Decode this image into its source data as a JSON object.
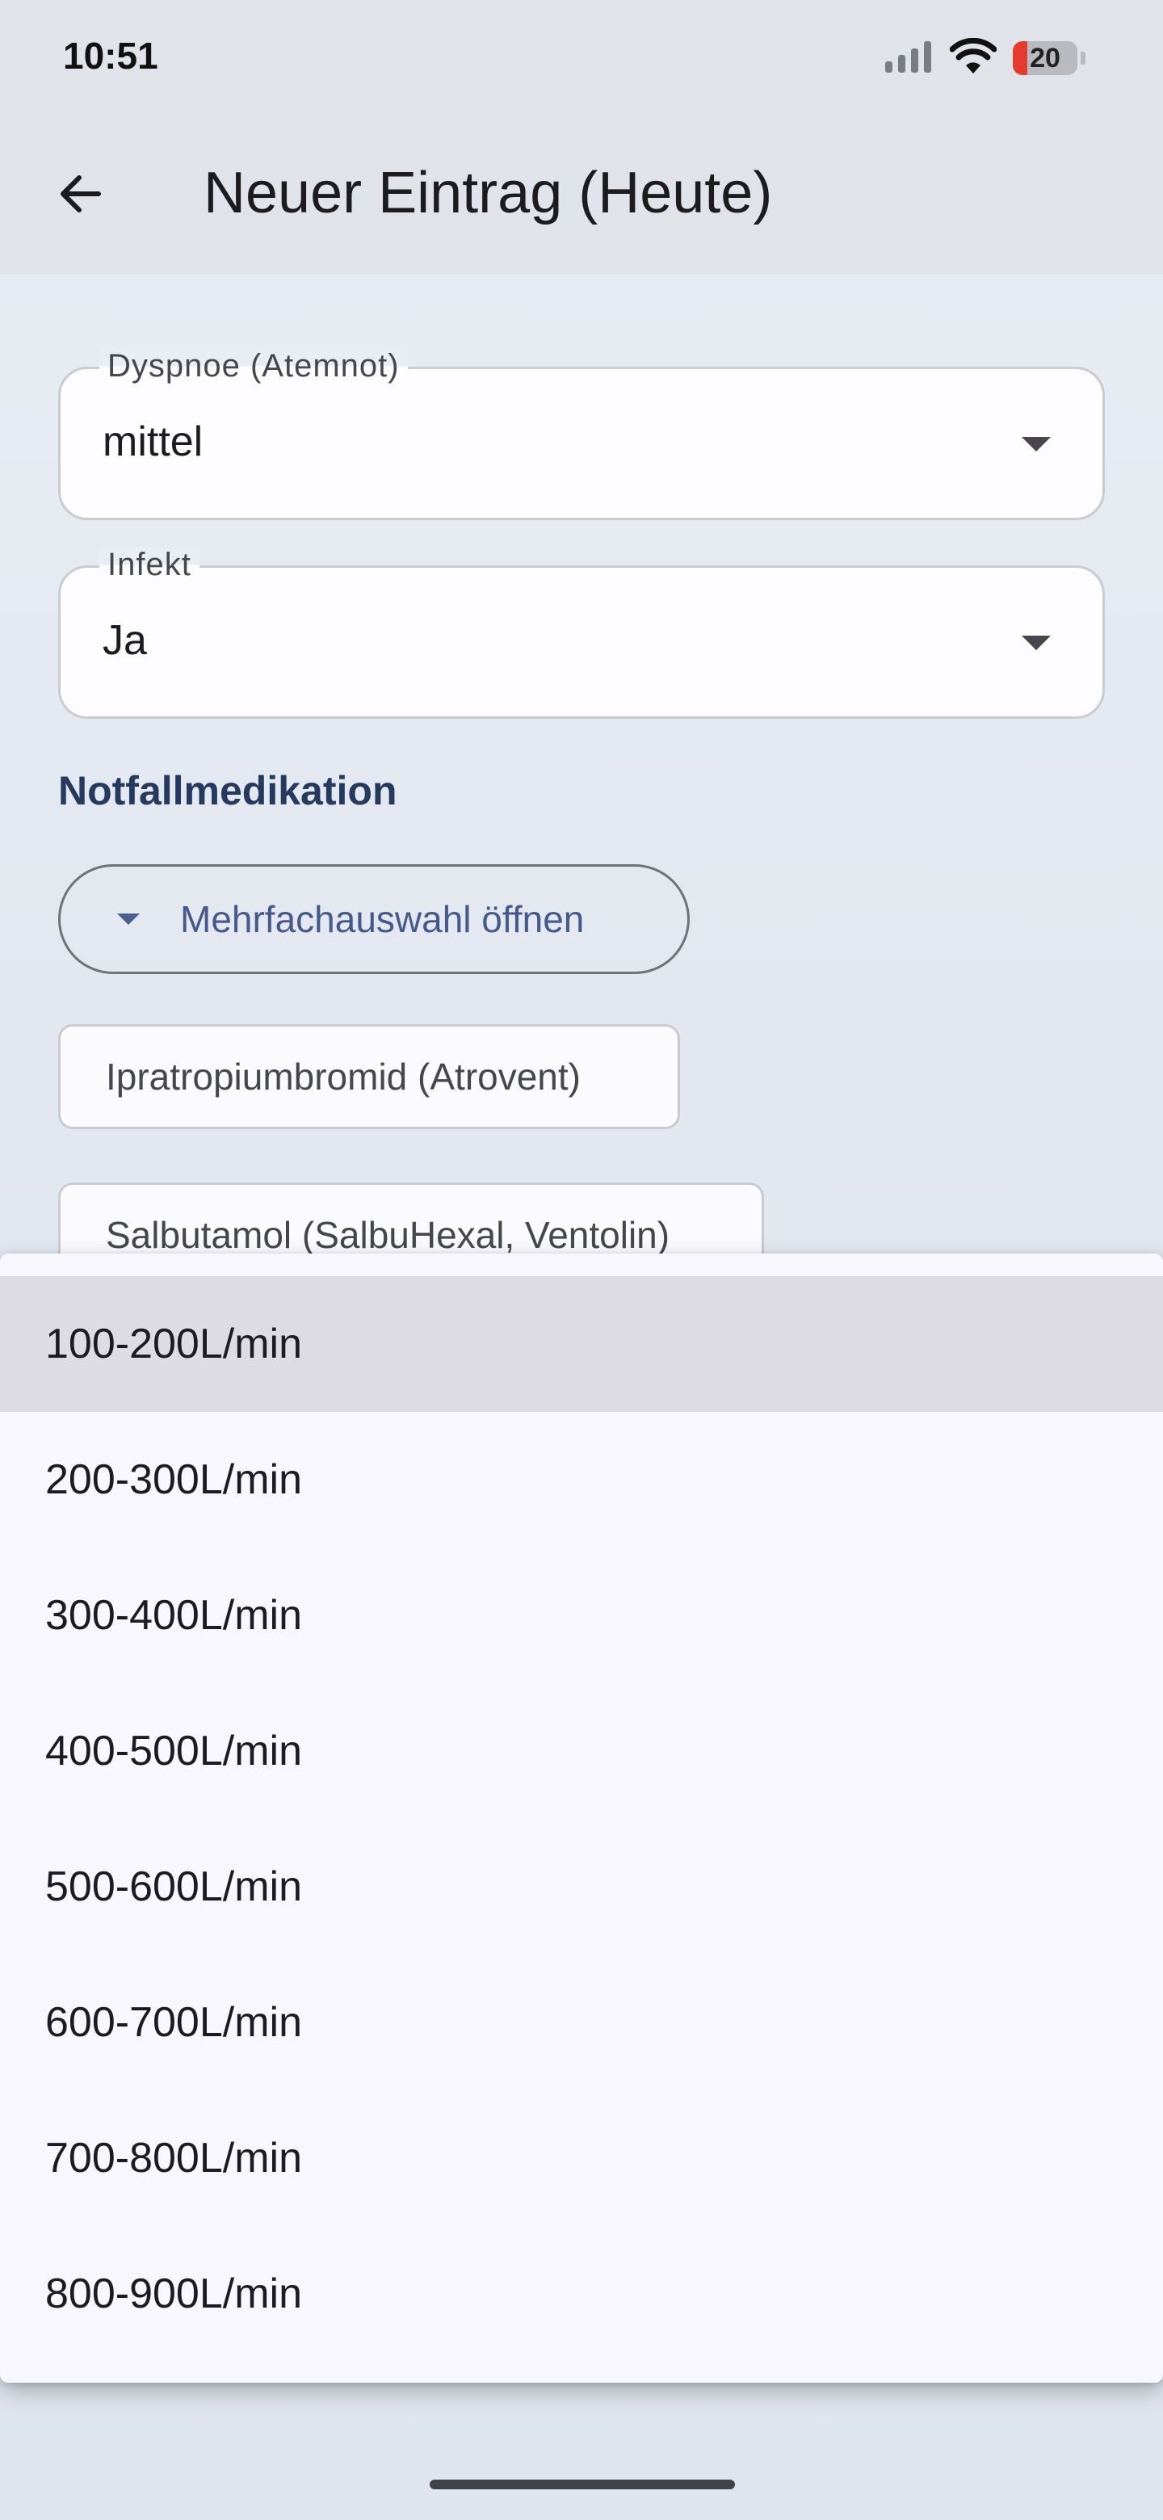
{
  "status_bar": {
    "time": "10:51",
    "battery": "20",
    "icons": [
      "signal-icon",
      "wifi-icon",
      "battery-icon"
    ]
  },
  "app_bar": {
    "back_icon": "arrow-left-icon",
    "title": "Neuer Eintrag (Heute)"
  },
  "form": {
    "dyspnoe": {
      "label": "Dyspnoe (Atemnot)",
      "value": "mittel"
    },
    "infekt": {
      "label": "Infekt",
      "value": "Ja"
    },
    "notfall": {
      "section_title": "Notfallmedikation",
      "multi_select_label": "Mehrfachauswahl öffnen",
      "chips": [
        "Ipratropiumbromid (Atrovent)",
        "Salbutamol (SalbuHexal, Ventolin)"
      ]
    }
  },
  "dropdown_menu": {
    "selected_index": 0,
    "options": [
      "100-200L/min",
      "200-300L/min",
      "300-400L/min",
      "400-500L/min",
      "500-600L/min",
      "600-700L/min",
      "700-800L/min",
      "800-900L/min"
    ]
  },
  "colors": {
    "accent": "#455a8a",
    "section_title": "#253a5e",
    "menu_background": "#f8f7fd",
    "menu_highlight": "#dedce3",
    "battery_low": "#e33c2e"
  }
}
